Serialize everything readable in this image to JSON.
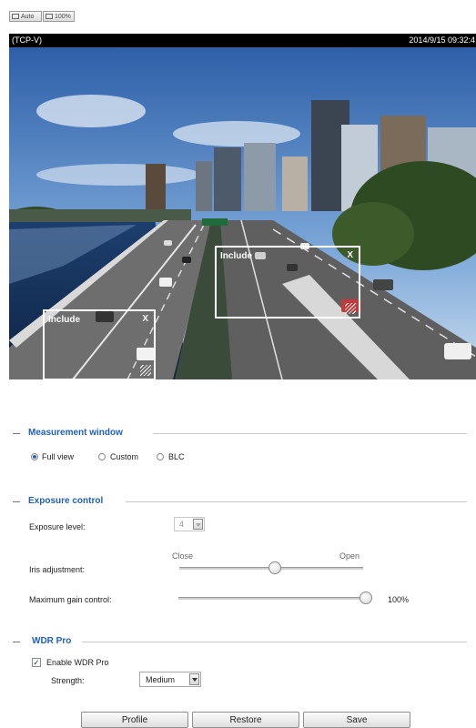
{
  "toolbar": {
    "auto_label": "Auto",
    "zoom_100_label": "100%"
  },
  "video": {
    "source_label": "(TCP-V)",
    "timestamp": "2014/9/15 09:32:4",
    "roi_windows": [
      {
        "label": "Include",
        "close_glyph": "X"
      },
      {
        "label": "Include",
        "close_glyph": "X"
      }
    ]
  },
  "measurement": {
    "title": "Measurement window",
    "options": [
      "Full view",
      "Custom",
      "BLC"
    ],
    "selected": "Full view"
  },
  "exposure": {
    "title": "Exposure control",
    "level_label": "Exposure level:",
    "level_value": "4",
    "iris_label": "Iris adjustment:",
    "iris_close": "Close",
    "iris_open": "Open",
    "iris_position": 0.52,
    "gain_label": "Maximum gain control:",
    "gain_value": "100%",
    "gain_position": 1.0
  },
  "wdr": {
    "title": "WDR Pro",
    "enable_label": "Enable WDR Pro",
    "enabled": true,
    "check_glyph": "✓",
    "strength_label": "Strength:",
    "strength_value": "Medium"
  },
  "buttons": {
    "profile": "Profile",
    "restore": "Restore",
    "save": "Save"
  },
  "colors": {
    "section_title": "#1f5fbf",
    "video_bar": "#000000"
  }
}
